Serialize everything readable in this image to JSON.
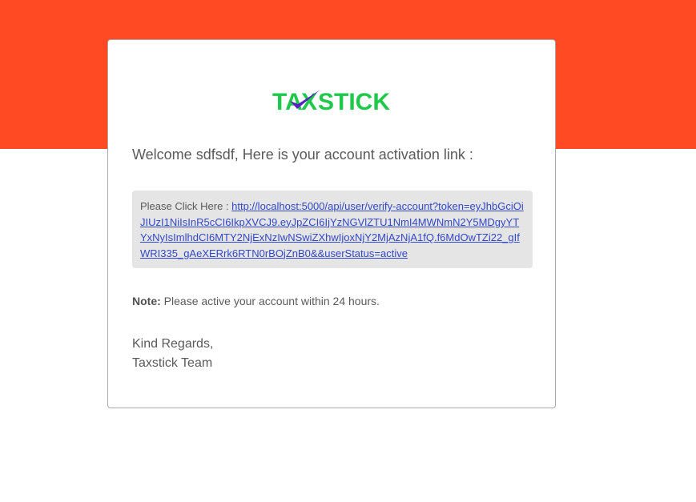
{
  "brand": {
    "logo_text_left": "TA",
    "logo_text_x": "X",
    "logo_text_right": "STICK",
    "green": "#1ec84b",
    "check_purple": "#5a1fc0",
    "band_color": "#ff4a24"
  },
  "email": {
    "welcome": "Welcome sdfsdf, Here is your account activation link :",
    "link_prefix": "Please Click Here : ",
    "activation_link": "http://localhost:5000/api/user/verify-account?token=eyJhbGciOiJIUzI1NiIsInR5cCI6IkpXVCJ9.eyJpZCI6IjYzNGVlZTU1NmI4MWNmN2Y5MDgyYTYxNyIsImlhdCI6MTY2NjExNzIwNSwiZXhwIjoxNjY2MjAzNjA1fQ.f6MdOwTZi22_gIfWRI335_gAeXERrk6RTN0rBOjZnB0&&userStatus=active",
    "note_label": "Note:",
    "note_text": " Please active your account within 24 hours.",
    "regards_line1": "Kind Regards,",
    "regards_line2": "Taxstick Team"
  }
}
